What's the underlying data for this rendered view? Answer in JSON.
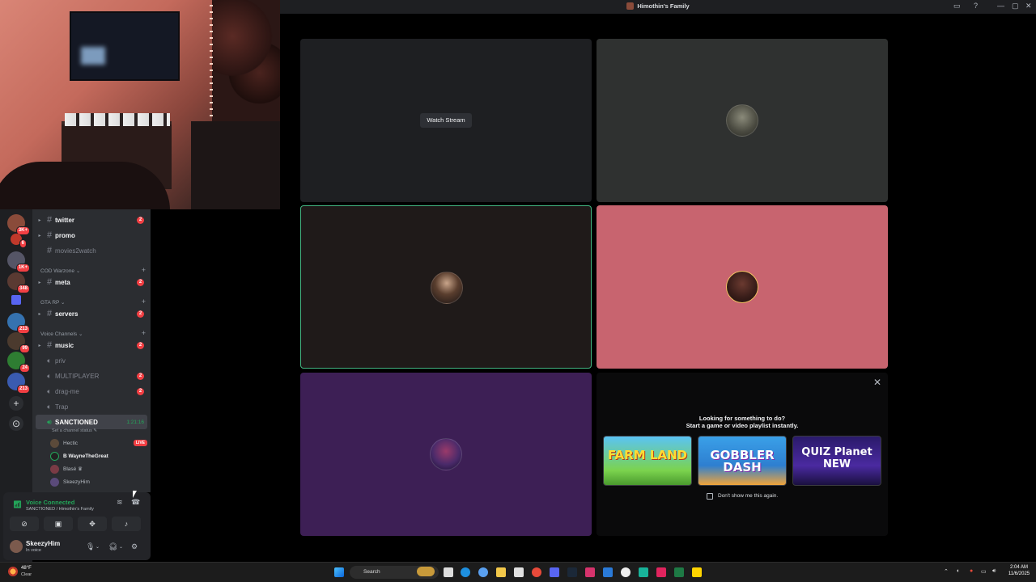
{
  "window": {
    "title": "Himothin's Family",
    "buttons": [
      "▭",
      "?",
      "—",
      "▢",
      "✕"
    ]
  },
  "sidebar": {
    "channels": [
      {
        "name": "twitter",
        "type": "text",
        "unread": true,
        "badge": "2"
      },
      {
        "name": "promo",
        "type": "text",
        "unread": true,
        "badge": ""
      },
      {
        "name": "movies2watch",
        "type": "text",
        "unread": false,
        "badge": ""
      }
    ],
    "categories": [
      {
        "name": "COD Warzone ⌄",
        "channel": "meta",
        "badge": "2"
      },
      {
        "name": "GTA RP ⌄",
        "channel": "servers",
        "badge": "2"
      },
      {
        "name": "Voice Channels ⌄",
        "channel": "music",
        "badge": "2"
      }
    ],
    "voice": [
      {
        "name": "priv",
        "badge": ""
      },
      {
        "name": "MULTIPLAYER",
        "badge": "2"
      },
      {
        "name": "drag-me",
        "badge": "2"
      },
      {
        "name": "Trap",
        "badge": ""
      }
    ],
    "active_voice": {
      "name": "SANCTIONED",
      "timer": "1:21:16",
      "status": "Set a channel status ✎"
    },
    "voice_users": [
      {
        "name": "Hectic",
        "live": "LIVE"
      },
      {
        "name": "B WayneTheGreat",
        "live": ""
      },
      {
        "name": "Blasé ♛",
        "live": ""
      },
      {
        "name": "SkeezyHim",
        "live": ""
      }
    ]
  },
  "servers": {
    "badges": [
      "3K+",
      "6",
      "1K+",
      "348",
      "213",
      "99",
      "24",
      "213"
    ]
  },
  "voice_panel": {
    "status": "Voice Connected",
    "sub": "SANCTIONED / Himothin's Family",
    "buttons": [
      "video-off-icon",
      "screen-share-icon",
      "activities-icon",
      "soundboard-icon"
    ]
  },
  "user": {
    "name": "SkeezyHim",
    "status": "In voice"
  },
  "stage": {
    "watch_stream": "Watch Stream",
    "activity": {
      "title": "Looking for something to do?",
      "subtitle": "Start a game or video playlist instantly.",
      "games": [
        "FARM LAND",
        "GOBBLER DASH",
        "QUIZ Planet NEW"
      ],
      "dont_show": "Don't show me this again."
    }
  },
  "taskbar": {
    "weather_temp": "48°F",
    "weather_cond": "Clear",
    "search": "Search",
    "time": "2:04 AM",
    "date": "11/6/2025"
  },
  "colors": {
    "tile_stream": "#1e1f22",
    "tile_2": "#2f3130",
    "tile_3": "#1f1a19",
    "tile_4": "#c8646f",
    "tile_5": "#3d1f55",
    "speaking_border": "#43b581"
  }
}
